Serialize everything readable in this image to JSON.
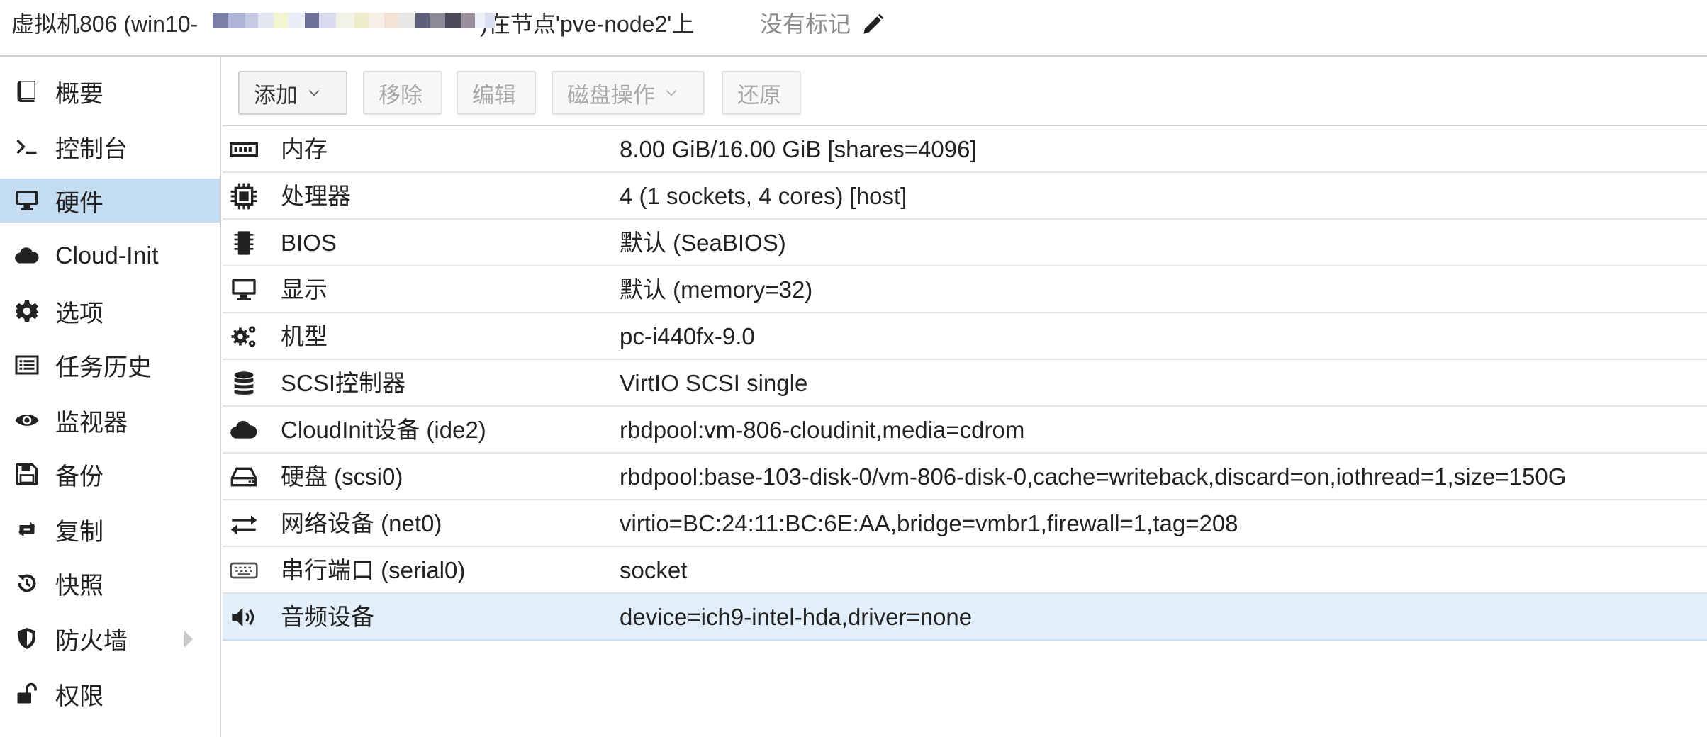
{
  "header": {
    "title_prefix": "虚拟机806 (win10-",
    "title_suffix": ")在节点'pve-node2'上",
    "tags_text": "没有标记",
    "edit_icon": "pencil-icon"
  },
  "sidebar": {
    "items": [
      {
        "label": "概要",
        "icon": "book-icon"
      },
      {
        "label": "控制台",
        "icon": "terminal-icon"
      },
      {
        "label": "硬件",
        "icon": "desktop-icon",
        "active": true
      },
      {
        "label": "Cloud-Init",
        "icon": "cloud-icon"
      },
      {
        "label": "选项",
        "icon": "gear-icon"
      },
      {
        "label": "任务历史",
        "icon": "list-icon"
      },
      {
        "label": "监视器",
        "icon": "eye-icon"
      },
      {
        "label": "备份",
        "icon": "floppy-icon"
      },
      {
        "label": "复制",
        "icon": "retweet-icon"
      },
      {
        "label": "快照",
        "icon": "history-icon"
      },
      {
        "label": "防火墙",
        "icon": "shield-icon",
        "expandable": true
      },
      {
        "label": "权限",
        "icon": "unlock-icon"
      }
    ]
  },
  "toolbar": {
    "add_label": "添加",
    "remove_label": "移除",
    "edit_label": "编辑",
    "disk_action_label": "磁盘操作",
    "revert_label": "还原"
  },
  "hardware": {
    "rows": [
      {
        "name": "内存",
        "value": "8.00 GiB/16.00 GiB [shares=4096]",
        "icon": "memory-icon"
      },
      {
        "name": "处理器",
        "value": "4 (1 sockets, 4 cores) [host]",
        "icon": "cpu-icon"
      },
      {
        "name": "BIOS",
        "value": "默认 (SeaBIOS)",
        "icon": "microchip-icon"
      },
      {
        "name": "显示",
        "value": "默认 (memory=32)",
        "icon": "desktop-icon"
      },
      {
        "name": "机型",
        "value": "pc-i440fx-9.0",
        "icon": "cogs-icon"
      },
      {
        "name": "SCSI控制器",
        "value": "VirtIO SCSI single",
        "icon": "database-icon"
      },
      {
        "name": "CloudInit设备 (ide2)",
        "value": "rbdpool:vm-806-cloudinit,media=cdrom",
        "icon": "cloud-icon"
      },
      {
        "name": "硬盘 (scsi0)",
        "value": "rbdpool:base-103-disk-0/vm-806-disk-0,cache=writeback,discard=on,iothread=1,size=150G",
        "icon": "hdd-icon"
      },
      {
        "name": "网络设备 (net0)",
        "value": "virtio=BC:24:11:BC:6E:AA,bridge=vmbr1,firewall=1,tag=208",
        "icon": "exchange-icon"
      },
      {
        "name": "串行端口 (serial0)",
        "value": "socket",
        "icon": "keyboard-icon"
      },
      {
        "name": "音频设备",
        "value": "device=ich9-intel-hda,driver=none",
        "icon": "volume-icon",
        "selected": true
      }
    ]
  },
  "colors": {
    "nav_active_bg": "#c4dcf2",
    "row_selected_bg": "#e2eef9",
    "border": "#cfcfcf"
  }
}
